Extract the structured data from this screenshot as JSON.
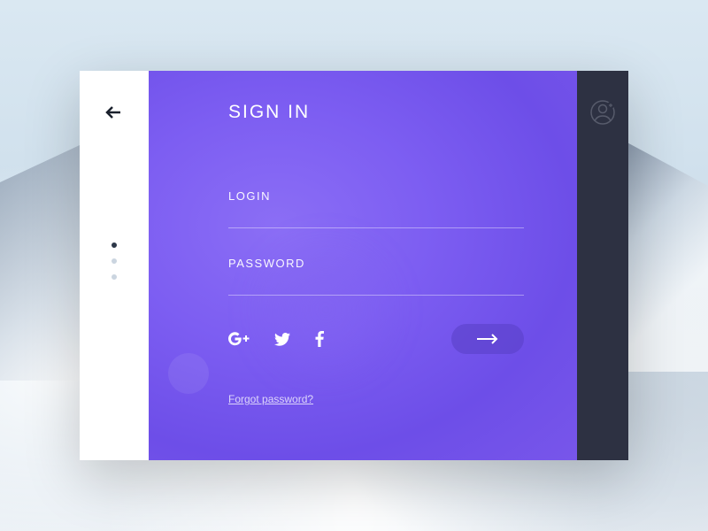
{
  "header": {
    "title": "SIGN IN"
  },
  "fields": {
    "login": {
      "label": "LOGIN",
      "value": ""
    },
    "password": {
      "label": "PASSWORD",
      "value": ""
    }
  },
  "social": {
    "google": "google-plus",
    "twitter": "twitter",
    "facebook": "facebook"
  },
  "links": {
    "forgot": "Forgot password?"
  },
  "nav": {
    "dots": [
      true,
      false,
      false
    ]
  }
}
